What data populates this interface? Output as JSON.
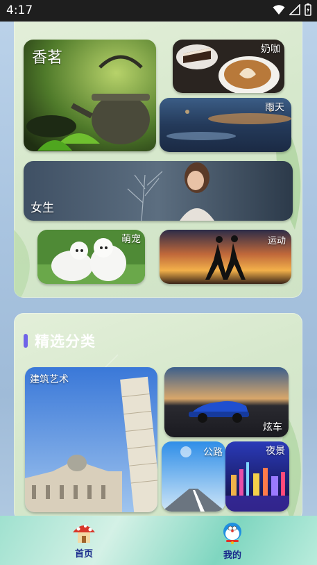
{
  "status": {
    "time": "4:17"
  },
  "featured": {
    "tiles": [
      {
        "label": "香茗",
        "icon": "teapot-image"
      },
      {
        "label": "奶咖",
        "icon": "coffee-image"
      },
      {
        "label": "雨天",
        "icon": "rainy-street-image"
      },
      {
        "label": "女生",
        "icon": "girl-image"
      },
      {
        "label": "萌宠",
        "icon": "pet-dogs-image"
      },
      {
        "label": "运动",
        "icon": "running-silhouette-image"
      }
    ]
  },
  "categories": {
    "title": "精选分类",
    "tiles": [
      {
        "label": "建筑艺术",
        "icon": "leaning-tower-image"
      },
      {
        "label": "炫车",
        "icon": "sports-car-image"
      },
      {
        "label": "公路",
        "icon": "road-image"
      },
      {
        "label": "夜景",
        "icon": "city-night-image"
      }
    ]
  },
  "nav": {
    "home_label": "首页",
    "mine_label": "我的"
  },
  "colors": {
    "accent": "#6f63e8",
    "nav_text": "#1a2b8c"
  }
}
